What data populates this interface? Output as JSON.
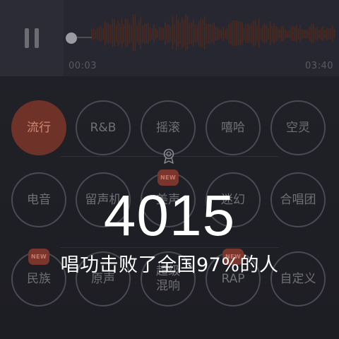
{
  "player": {
    "state_icon": "pause-icon",
    "current_time": "00:03",
    "total_time": "03:40",
    "progress_fraction": 0.014
  },
  "genres": [
    {
      "label": "流行",
      "active": true,
      "new": false
    },
    {
      "label": "R&B",
      "active": false,
      "new": false
    },
    {
      "label": "摇滚",
      "active": false,
      "new": false
    },
    {
      "label": "嘻哈",
      "active": false,
      "new": false
    },
    {
      "label": "空灵",
      "active": false,
      "new": false
    },
    {
      "label": "电音",
      "active": false,
      "new": false
    },
    {
      "label": "留声机",
      "active": false,
      "new": false
    },
    {
      "label": "美声",
      "active": false,
      "new": true
    },
    {
      "label": "迷幻",
      "active": false,
      "new": false
    },
    {
      "label": "合唱团",
      "active": false,
      "new": false
    },
    {
      "label": "民族",
      "active": false,
      "new": true
    },
    {
      "label": "原声",
      "active": false,
      "new": false
    },
    {
      "label": "超级混响",
      "active": false,
      "new": false
    },
    {
      "label": "RAP",
      "active": false,
      "new": true
    },
    {
      "label": "自定义",
      "active": false,
      "new": false
    }
  ],
  "new_badge": "NEW",
  "result": {
    "score": "4015",
    "beat_text": "唱功击败了全国97%的人"
  },
  "colors": {
    "accent": "#6e3229",
    "wave": "#4a2a20"
  }
}
